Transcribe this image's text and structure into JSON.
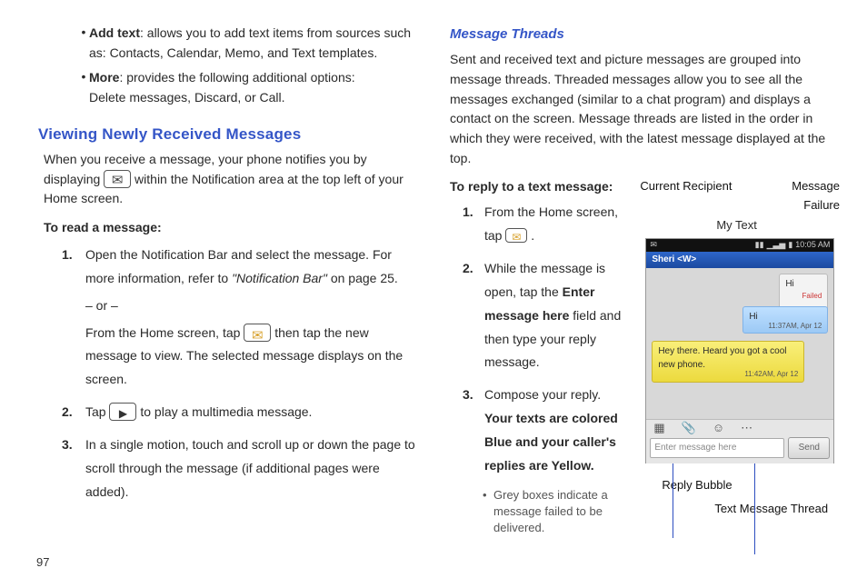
{
  "left": {
    "bullets": [
      {
        "label": "Add text",
        "text": ": allows you to add text items from sources such as: Contacts, Calendar, Memo, and Text templates."
      },
      {
        "label": "More",
        "text": ": provides the following additional options:",
        "sub": "Delete messages, Discard, or Call."
      }
    ],
    "heading": "Viewing Newly Received Messages",
    "intro_a": "When you receive a message, your phone notifies you by displaying ",
    "intro_b": " within the Notification area at the top left of your Home screen.",
    "to_read": "To read a message:",
    "s1a": "Open the Notification Bar and select the message. For more information, refer to ",
    "s1_ref": "\"Notification Bar\"",
    "s1b": "  on page 25.",
    "s1_or": "– or –",
    "s1c_a": "From the Home screen, tap ",
    "s1c_b": " then tap the new message to view. The selected message displays on the screen.",
    "s2a": "Tap  ",
    "s2b": "  to play a multimedia message.",
    "s3": "In a single motion, touch and scroll up or down the page to scroll through the message (if additional pages were added).",
    "page": "97"
  },
  "right": {
    "heading": "Message Threads",
    "para": "Sent and received text and picture messages are grouped into message threads. Threaded messages allow you to see all the messages exchanged (similar to a chat program) and displays a contact on the screen. Message threads are listed in the order in which they were received, with the latest message displayed at the top.",
    "to_reply": "To reply to a text message:",
    "s1a": "From the Home screen, tap ",
    "s1b": " .",
    "s2a": "While the message is open, tap the ",
    "s2_bold": "Enter message here",
    "s2b": " field and then type your reply message.",
    "s3a": "Compose your reply.",
    "s3_boldline": "Your texts are colored Blue and your caller's replies are Yellow.",
    "grey_note": "Grey boxes indicate a message failed to be delivered.",
    "labels": {
      "current_recipient": "Current Recipient",
      "my_text": "My Text",
      "msg_failure_1": "Message",
      "msg_failure_2": "Failure",
      "reply_bubble": "Reply Bubble",
      "thread": "Text Message Thread"
    },
    "phone": {
      "time": "10:05 AM",
      "recipient": "Sheri <W>",
      "grey_text": "Hi",
      "grey_fail": "Failed",
      "blue_text": "Hi",
      "blue_time": "11:37AM, Apr 12",
      "yellow_text": "Hey there. Heard you got a cool new phone.",
      "yellow_time": "11:42AM, Apr 12",
      "placeholder": "Enter message here",
      "send": "Send"
    }
  }
}
